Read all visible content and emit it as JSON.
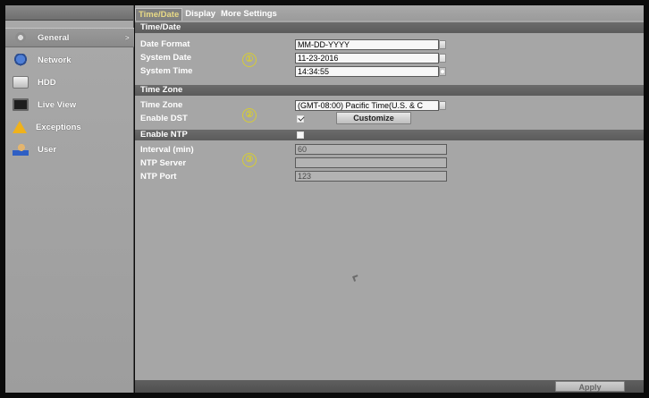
{
  "sidebar": {
    "items": [
      {
        "label": "General",
        "icon": "gear-icon",
        "active": true
      },
      {
        "label": "Network",
        "icon": "network-icon",
        "active": false
      },
      {
        "label": "HDD",
        "icon": "hdd-icon",
        "active": false
      },
      {
        "label": "Live View",
        "icon": "monitor-icon",
        "active": false
      },
      {
        "label": "Exceptions",
        "icon": "warning-icon",
        "active": false
      },
      {
        "label": "User",
        "icon": "user-icon",
        "active": false
      }
    ],
    "active_arrow": ">"
  },
  "tabs": [
    {
      "label": "Time/Date",
      "active": true
    },
    {
      "label": "Display",
      "active": false
    },
    {
      "label": "More Settings",
      "active": false
    }
  ],
  "sections": {
    "time_date": "Time/Date",
    "time_zone": "Time Zone",
    "ntp": "Enable NTP"
  },
  "fields": {
    "date_format": {
      "label": "Date Format",
      "value": "MM-DD-YYYY"
    },
    "system_date": {
      "label": "System Date",
      "value": "11-23-2016"
    },
    "system_time": {
      "label": "System Time",
      "value": "14:34:55"
    },
    "time_zone": {
      "label": "Time Zone",
      "value": "(GMT-08:00) Pacific Time(U.S. & C"
    },
    "enable_dst": {
      "label": "Enable DST",
      "checked": true
    },
    "interval": {
      "label": "Interval (min)",
      "value": "60"
    },
    "ntp_server": {
      "label": "NTP Server",
      "value": ""
    },
    "ntp_port": {
      "label": "NTP Port",
      "value": "123"
    },
    "enable_ntp": {
      "checked": false
    }
  },
  "buttons": {
    "customize": "Customize",
    "apply": "Apply"
  },
  "annotations": [
    "①",
    "②",
    "③"
  ],
  "colors": {
    "active_tab_text": "#e9da86",
    "annotation": "#d6cc35"
  }
}
